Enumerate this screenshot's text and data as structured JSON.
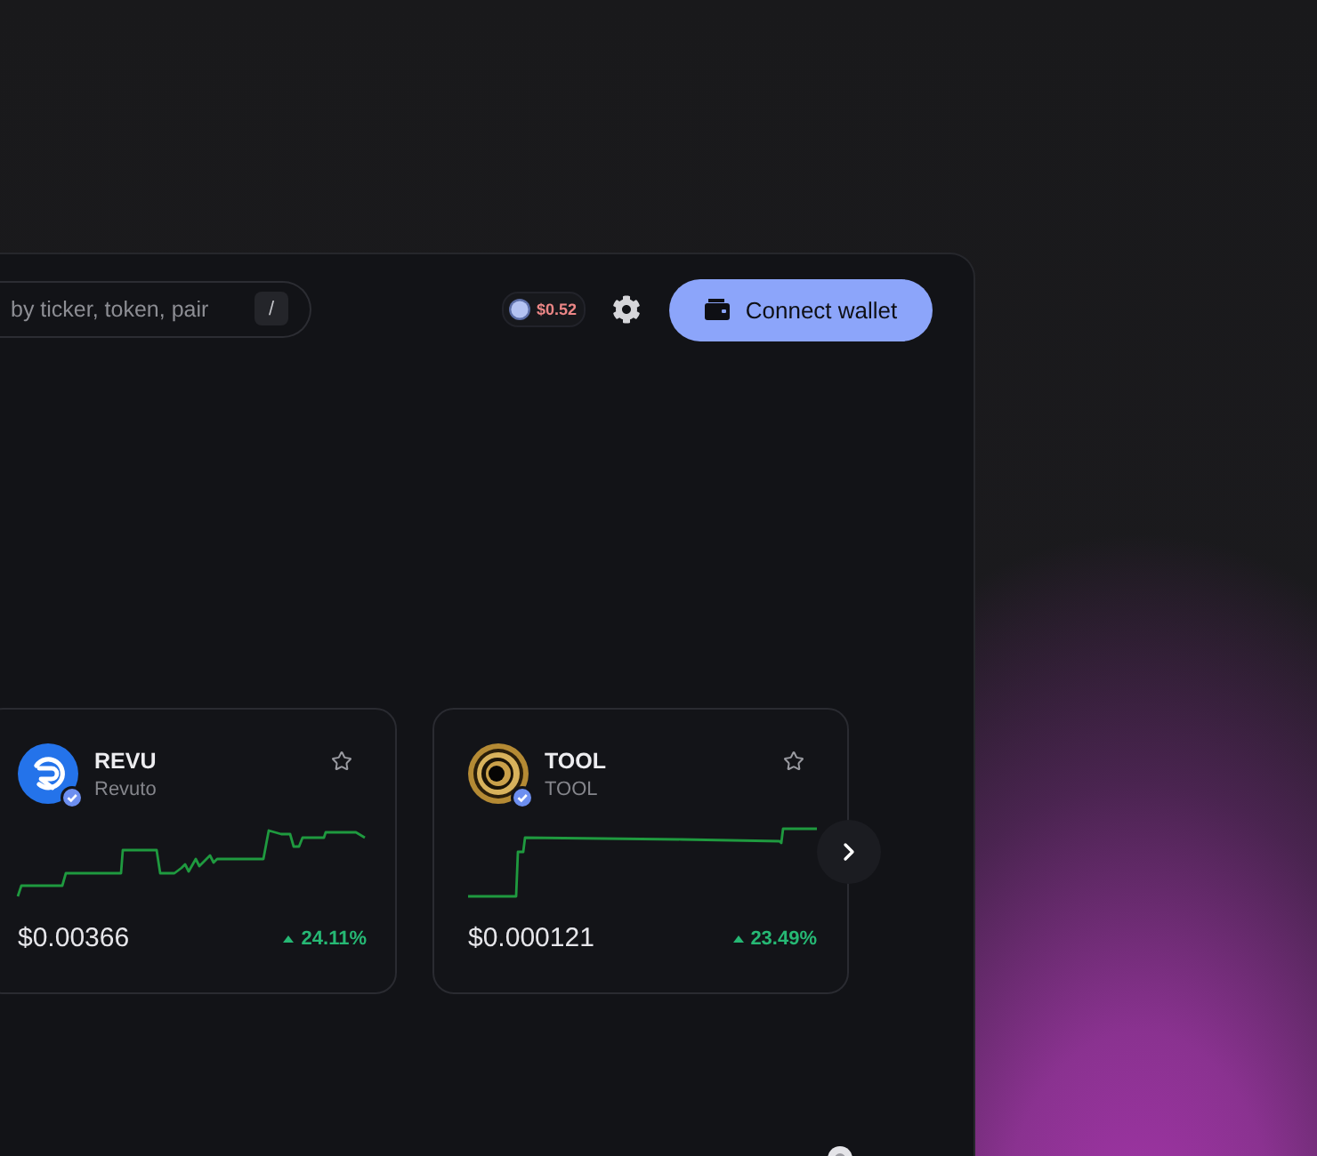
{
  "search": {
    "placeholder": "by ticker, token, pair",
    "shortcut": "/"
  },
  "price_pill": {
    "value": "$0.52"
  },
  "connect_button": {
    "label": "Connect wallet"
  },
  "tokens": [
    {
      "symbol": "REVU",
      "name": "Revuto",
      "kind": "r-mark",
      "verified": true,
      "favorite": false,
      "price": "$0.00366",
      "rising": true,
      "change": "24.11%"
    },
    {
      "symbol": "TOOL",
      "name": "TOOL",
      "kind": "rings",
      "verified": true,
      "favorite": false,
      "price": "$0.000121",
      "rising": true,
      "change": "23.49%"
    }
  ]
}
